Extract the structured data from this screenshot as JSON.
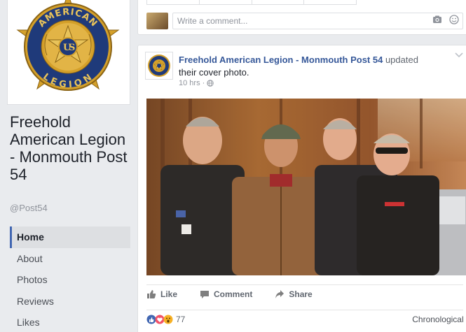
{
  "page": {
    "name": "Freehold American Legion - Monmouth Post 54",
    "handle": "@Post54",
    "logo_text": [
      "AMERICAN",
      "LEGION",
      "U",
      "S"
    ]
  },
  "nav": {
    "items": [
      {
        "label": "Home"
      },
      {
        "label": "About"
      },
      {
        "label": "Photos"
      },
      {
        "label": "Reviews"
      },
      {
        "label": "Likes"
      }
    ]
  },
  "comment_box": {
    "placeholder": "Write a comment..."
  },
  "post": {
    "author": "Freehold American Legion - Monmouth Post 54",
    "action": "updated",
    "action_line2": "their cover photo.",
    "time": "10 hrs",
    "actions": {
      "like": "Like",
      "comment": "Comment",
      "share": "Share"
    },
    "reactions_count": "77",
    "sort_label": "Chronological"
  },
  "colors": {
    "brand_link": "#365899",
    "nav_active_border": "#4267b2",
    "logo_gold": "#d4a02a",
    "logo_blue": "#1f3a7a"
  },
  "icons": [
    "camera-icon",
    "smile-icon",
    "globe-icon",
    "chevron-down-icon",
    "like-thumb-icon",
    "comment-icon",
    "share-arrow-icon",
    "reaction-like-icon",
    "reaction-love-icon",
    "reaction-wow-icon"
  ]
}
